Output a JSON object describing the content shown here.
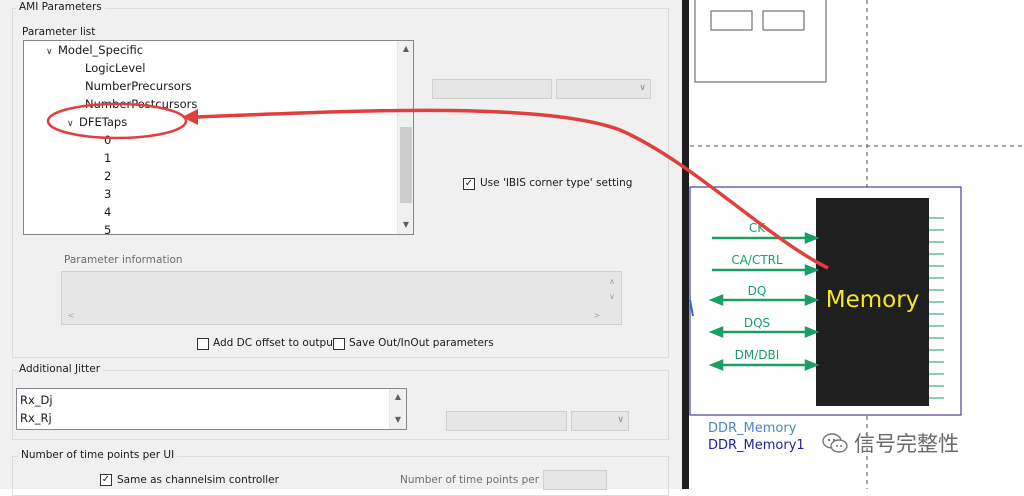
{
  "ami": {
    "group_title": "AMI Parameters",
    "parameter_list_label": "Parameter list",
    "tree": [
      {
        "label": "Model_Specific",
        "expanded": true
      },
      {
        "label": "LogicLevel"
      },
      {
        "label": "NumberPrecursors"
      },
      {
        "label": "NumberPostcursors"
      },
      {
        "label": "DFETaps",
        "expanded": true,
        "highlighted": true
      },
      {
        "label": "0"
      },
      {
        "label": "1"
      },
      {
        "label": "2"
      },
      {
        "label": "3"
      },
      {
        "label": "4"
      },
      {
        "label": "5"
      }
    ],
    "use_ibis_corner_label": "Use 'IBIS corner type' setting",
    "use_ibis_corner_checked": true,
    "parameter_information_label": "Parameter information",
    "add_dc_offset_label": "Add DC offset to output",
    "add_dc_offset_checked": false,
    "save_outinout_label": "Save Out/InOut parameters",
    "save_outinout_checked": false
  },
  "jitter": {
    "group_title": "Additional Jitter",
    "items": [
      "Rx_Dj",
      "Rx_Rj"
    ]
  },
  "timepoints": {
    "group_title": "Number of time points per UI",
    "same_as_label": "Same as channelsim controller",
    "same_as_checked": true,
    "number_label": "Number of time points per UI"
  },
  "schematic": {
    "block_label": "Memory",
    "signals": [
      "CK",
      "CA/CTRL",
      "DQ",
      "DQS",
      "DM/DBI"
    ],
    "component_type": "DDR_Memory",
    "instance_name": "DDR_Memory1",
    "watermark": "信号完整性",
    "colors": {
      "signal": "#1b9e65",
      "block": "#1f1f1f",
      "block_text": "#f5e626",
      "annotation": "#e0403d",
      "frame": "#44449a"
    }
  }
}
